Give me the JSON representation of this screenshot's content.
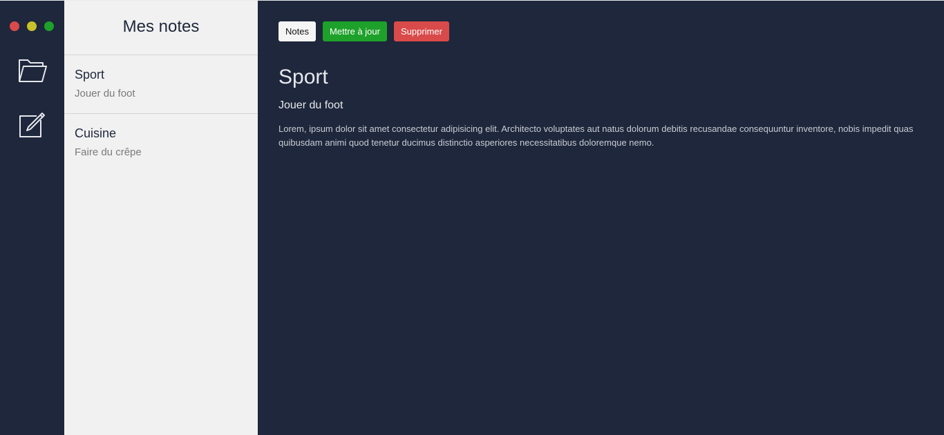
{
  "window": {
    "controls": [
      {
        "name": "close",
        "color": "#d94a4a"
      },
      {
        "name": "minimize",
        "color": "#c9c12a"
      },
      {
        "name": "maximize",
        "color": "#1ea12a"
      }
    ]
  },
  "rail": {
    "items": [
      {
        "icon": "folder-icon"
      },
      {
        "icon": "edit-icon"
      }
    ]
  },
  "list": {
    "title": "Mes notes",
    "notes": [
      {
        "title": "Sport",
        "subtitle": "Jouer du foot"
      },
      {
        "title": "Cuisine",
        "subtitle": "Faire du crêpe"
      }
    ]
  },
  "toolbar": {
    "notes_label": "Notes",
    "update_label": "Mettre à jour",
    "delete_label": "Supprimer"
  },
  "note": {
    "title": "Sport",
    "subtitle": "Jouer du foot",
    "body": "Lorem, ipsum dolor sit amet consectetur adipisicing elit. Architecto voluptates aut natus dolorum debitis recusandae consequuntur inventore, nobis impedit quas quibusdam animi quod tenetur ducimus distinctio asperiores necessitatibus doloremque nemo."
  },
  "colors": {
    "dark_bg": "#1e273b",
    "list_bg": "#f1f1f1",
    "success": "#1ea12a",
    "danger": "#d94a4a"
  }
}
